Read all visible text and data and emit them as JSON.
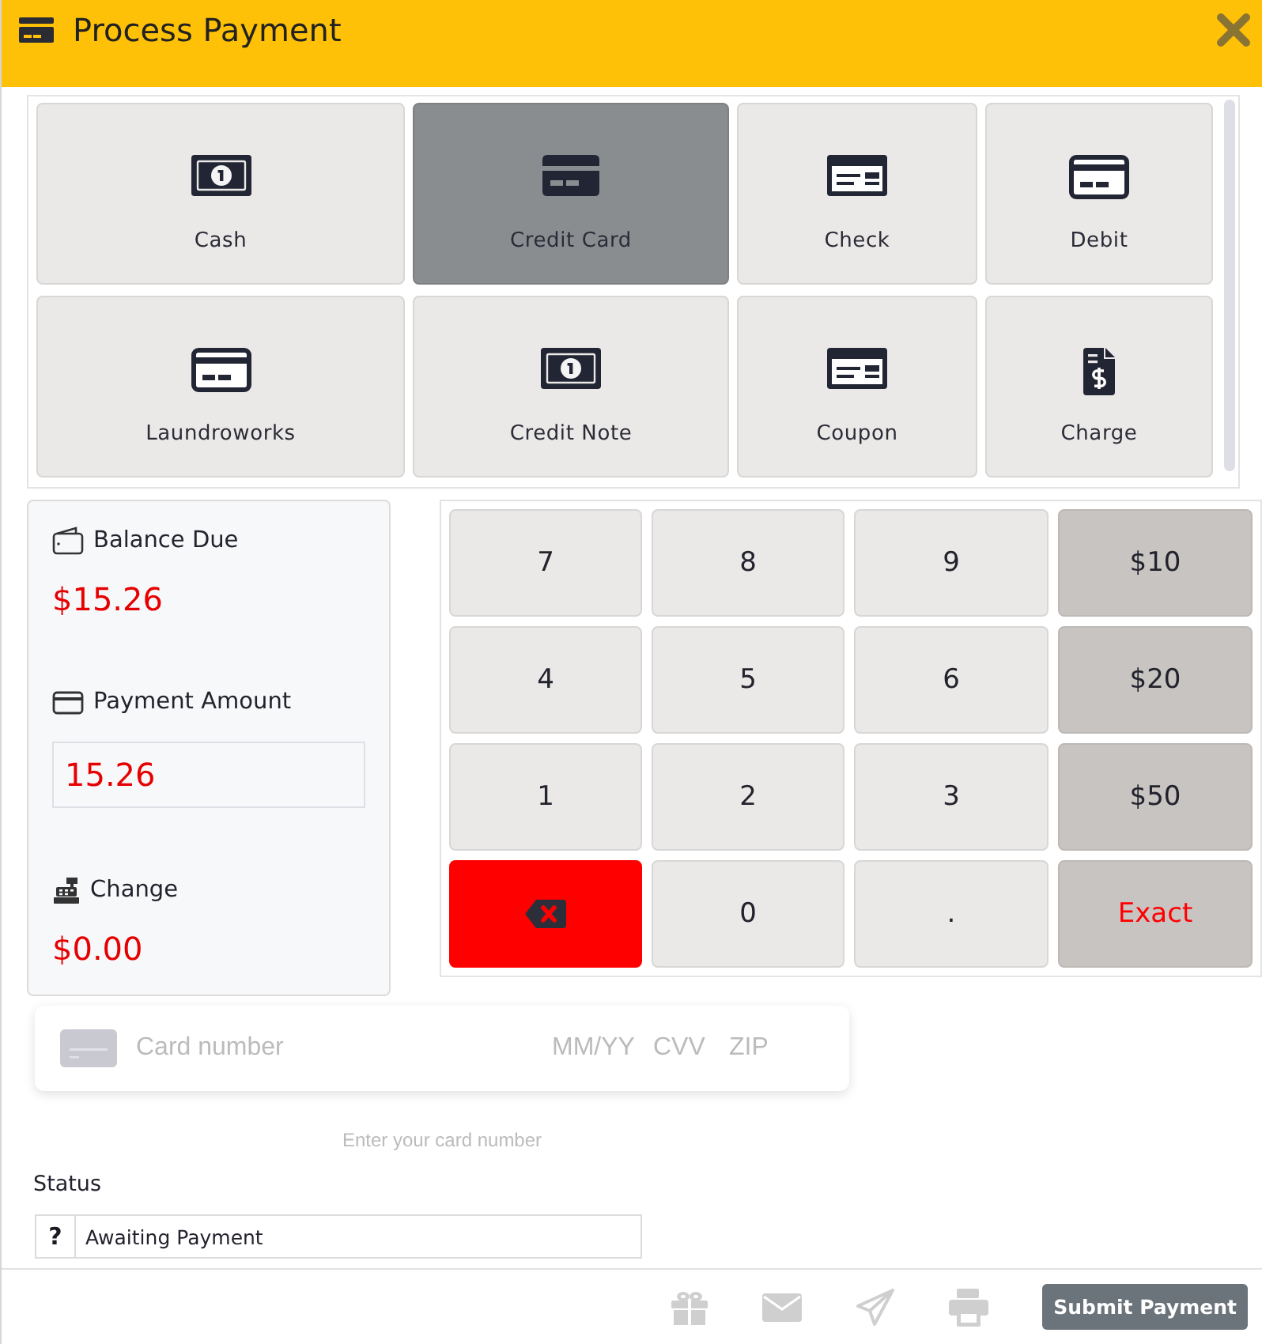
{
  "window": {
    "title": "Process Payment"
  },
  "payment_methods": [
    {
      "label": "Cash",
      "kind": "bill",
      "selected": false
    },
    {
      "label": "Credit Card",
      "kind": "creditcard",
      "selected": true
    },
    {
      "label": "Check",
      "kind": "check",
      "selected": false
    },
    {
      "label": "Debit",
      "kind": "card",
      "selected": false
    },
    {
      "label": "Laundroworks",
      "kind": "card",
      "selected": false
    },
    {
      "label": "Credit Note",
      "kind": "bill",
      "selected": false
    },
    {
      "label": "Coupon",
      "kind": "check",
      "selected": false
    },
    {
      "label": "Charge",
      "kind": "invoice",
      "selected": false
    }
  ],
  "summary": {
    "balance_due": {
      "label": "Balance Due",
      "value": "$15.26"
    },
    "payment_amount": {
      "label": "Payment Amount",
      "value": "15.26"
    },
    "change": {
      "label": "Change",
      "value": "$0.00"
    }
  },
  "keypad": [
    {
      "label": "7",
      "kind": "digit"
    },
    {
      "label": "8",
      "kind": "digit"
    },
    {
      "label": "9",
      "kind": "digit"
    },
    {
      "label": "$10",
      "kind": "amount"
    },
    {
      "label": "4",
      "kind": "digit"
    },
    {
      "label": "5",
      "kind": "digit"
    },
    {
      "label": "6",
      "kind": "digit"
    },
    {
      "label": "$20",
      "kind": "amount"
    },
    {
      "label": "1",
      "kind": "digit"
    },
    {
      "label": "2",
      "kind": "digit"
    },
    {
      "label": "3",
      "kind": "digit"
    },
    {
      "label": "$50",
      "kind": "amount"
    },
    {
      "kind": "backspace"
    },
    {
      "label": "0",
      "kind": "digit"
    },
    {
      "label": ".",
      "kind": "digit"
    },
    {
      "label": "Exact",
      "kind": "exact"
    }
  ],
  "card_form": {
    "number_placeholder": "Card number",
    "expiry_placeholder": "MM/YY",
    "cvv_placeholder": "CVV",
    "zip_placeholder": "ZIP",
    "hint": "Enter your card number"
  },
  "status": {
    "label": "Status",
    "addon": "?",
    "value": "Awaiting Payment"
  },
  "footer": {
    "actions": [
      {
        "kind": "gift",
        "disabled": true
      },
      {
        "kind": "email",
        "disabled": true
      },
      {
        "kind": "send",
        "disabled": true
      },
      {
        "kind": "print",
        "disabled": true
      }
    ],
    "submit": "Submit Payment"
  }
}
